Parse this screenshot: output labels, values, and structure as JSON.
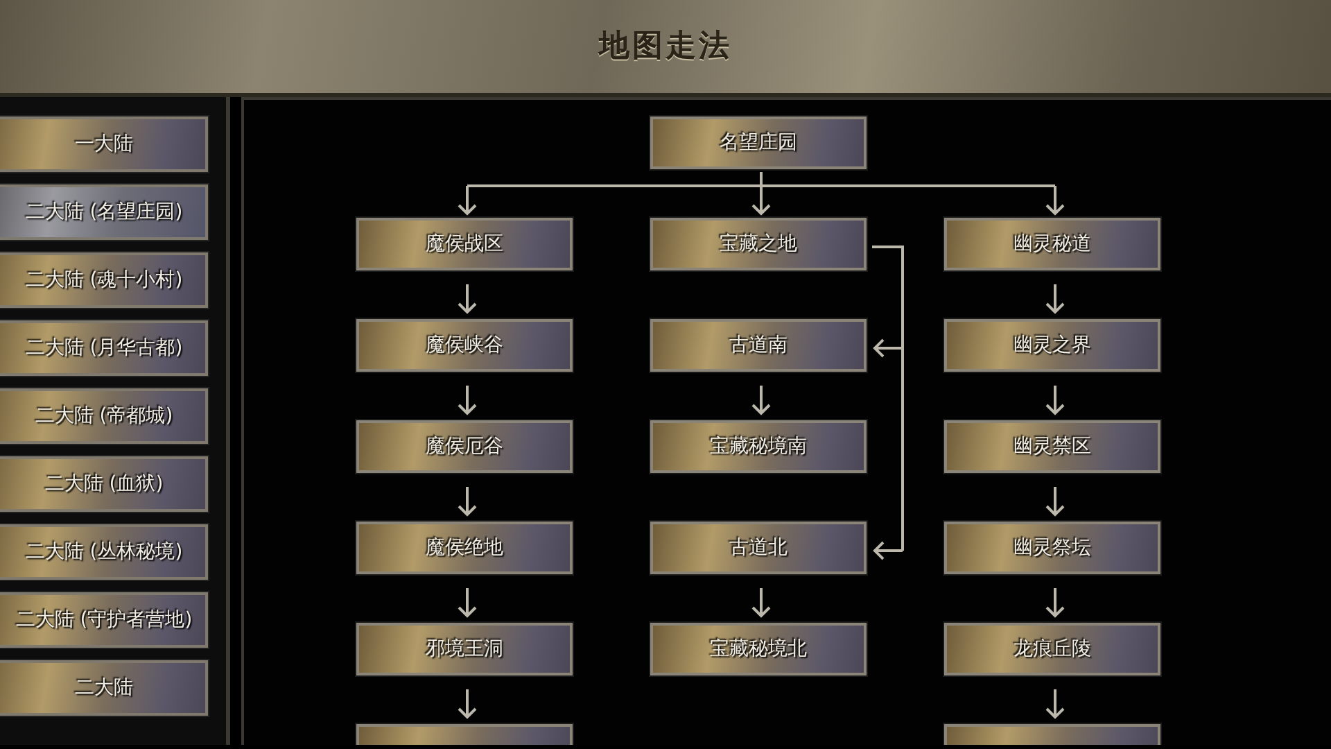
{
  "window": {
    "title": "地图走法"
  },
  "sidebar": {
    "items": [
      {
        "label": "一大陆",
        "selected": false
      },
      {
        "label": "二大陆 (名望庄园)",
        "selected": true
      },
      {
        "label": "二大陆 (魂十小村)",
        "selected": false
      },
      {
        "label": "二大陆 (月华古都)",
        "selected": false
      },
      {
        "label": "二大陆 (帝都城)",
        "selected": false
      },
      {
        "label": "二大陆 (血狱)",
        "selected": false
      },
      {
        "label": "二大陆 (丛林秘境)",
        "selected": false
      },
      {
        "label": "二大陆 (守护者营地)",
        "selected": false
      },
      {
        "label": "二大陆",
        "selected": false
      }
    ]
  },
  "map": {
    "root": "名望庄园",
    "columns": [
      {
        "nodes": [
          {
            "label": "魔侯战区",
            "kind": "arrow"
          },
          {
            "label": "魔侯峡谷",
            "kind": "arrow"
          },
          {
            "label": "魔侯厄谷",
            "kind": "arrow"
          },
          {
            "label": "魔侯绝地",
            "kind": "arrow"
          },
          {
            "label": "邪境王洞",
            "kind": "arrow"
          }
        ],
        "continues": true
      },
      {
        "nodes": [
          {
            "label": "宝藏之地",
            "kind": "arrow"
          },
          {
            "label": "古道南",
            "kind": "bracket"
          },
          {
            "label": "宝藏秘境南",
            "kind": "arrow"
          },
          {
            "label": "古道北",
            "kind": "bracket"
          },
          {
            "label": "宝藏秘境北",
            "kind": "arrow"
          }
        ],
        "continues": false
      },
      {
        "nodes": [
          {
            "label": "幽灵秘道",
            "kind": "arrow"
          },
          {
            "label": "幽灵之界",
            "kind": "arrow"
          },
          {
            "label": "幽灵禁区",
            "kind": "arrow"
          },
          {
            "label": "幽灵祭坛",
            "kind": "arrow"
          },
          {
            "label": "龙痕丘陵",
            "kind": "arrow"
          }
        ],
        "continues": true
      }
    ]
  }
}
